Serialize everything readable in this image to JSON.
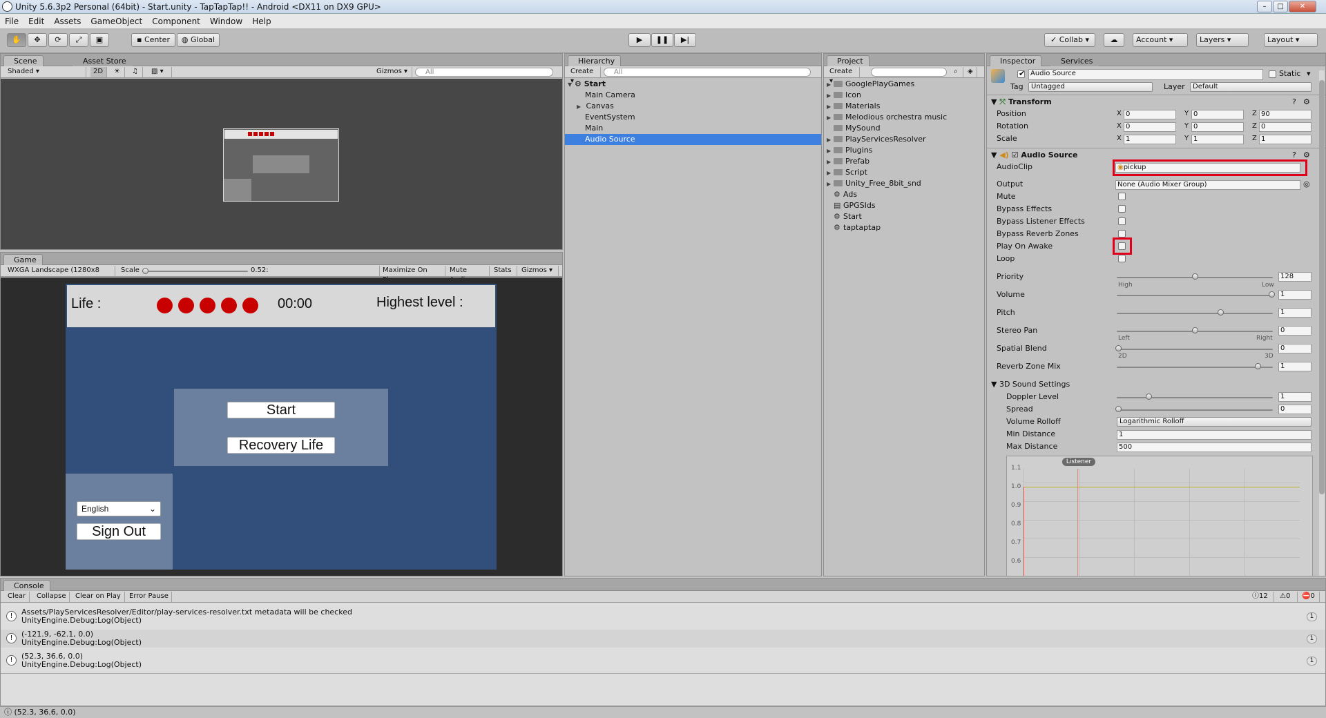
{
  "window": {
    "title": "Unity 5.6.3p2 Personal (64bit) - Start.unity - TapTapTap!! - Android <DX11 on DX9 GPU>"
  },
  "menu": [
    "File",
    "Edit",
    "Assets",
    "GameObject",
    "Component",
    "Window",
    "Help"
  ],
  "toolbar": {
    "center_label": "Center",
    "global_label": "Global",
    "collab_label": "Collab",
    "account_label": "Account",
    "layers_label": "Layers",
    "layout_label": "Layout"
  },
  "scene": {
    "tab_scene": "Scene",
    "tab_asset_store": "Asset Store",
    "shading": "Shaded",
    "mode_2d": "2D",
    "gizmos": "Gizmos",
    "search_placeholder": "All"
  },
  "game": {
    "tab": "Game",
    "resolution": "WXGA Landscape (1280x8",
    "scale_label": "Scale",
    "scale_value": "0.52:",
    "maximize": "Maximize On Play",
    "mute": "Mute Audio",
    "stats": "Stats",
    "gizmos": "Gizmos",
    "life_label": "Life :",
    "timer": "00:00",
    "highest_label": "Highest level :",
    "start_btn": "Start",
    "recovery_btn": "Recovery Life",
    "language": "English",
    "signout_btn": "Sign Out",
    "life_dots": 5,
    "colors": {
      "bg": "#324f7c",
      "header": "#d8d8d8",
      "dot": "#c80000",
      "panel": "#6b7f9e"
    }
  },
  "hierarchy": {
    "tab": "Hierarchy",
    "create": "Create",
    "search_placeholder": "All",
    "scene_name": "Start",
    "items": [
      "Main Camera",
      "Canvas",
      "EventSystem",
      "Main",
      "Audio Source"
    ],
    "selected": "Audio Source"
  },
  "project": {
    "tab": "Project",
    "create": "Create",
    "folders": [
      "GooglePlayGames",
      "Icon",
      "Materials",
      "Melodious orchestra music",
      "MySound",
      "PlayServicesResolver",
      "Plugins",
      "Prefab",
      "Script",
      "Unity_Free_8bit_snd"
    ],
    "files": [
      "Ads",
      "GPGSIds",
      "Start",
      "taptaptap"
    ]
  },
  "inspector": {
    "tab": "Inspector",
    "tab_services": "Services",
    "object_name": "Audio Source",
    "static_label": "Static",
    "tag_label": "Tag",
    "tag_value": "Untagged",
    "layer_label": "Layer",
    "layer_value": "Default",
    "transform": {
      "title": "Transform",
      "position_label": "Position",
      "position": [
        "0",
        "0",
        "90"
      ],
      "rotation_label": "Rotation",
      "rotation": [
        "0",
        "0",
        "0"
      ],
      "scale_label": "Scale",
      "scale": [
        "1",
        "1",
        "1"
      ]
    },
    "audio": {
      "title": "Audio Source",
      "audioclip_label": "AudioClip",
      "audioclip_value": "pickup",
      "output_label": "Output",
      "output_value": "None (Audio Mixer Group)",
      "mute_label": "Mute",
      "bypass_effects": "Bypass Effects",
      "bypass_listener": "Bypass Listener Effects",
      "bypass_reverb": "Bypass Reverb Zones",
      "play_on_awake": "Play On Awake",
      "loop": "Loop",
      "priority_label": "Priority",
      "priority_value": "128",
      "priority_high": "High",
      "priority_low": "Low",
      "volume_label": "Volume",
      "volume_value": "1",
      "pitch_label": "Pitch",
      "pitch_value": "1",
      "stereo_label": "Stereo Pan",
      "stereo_value": "0",
      "stereo_left": "Left",
      "stereo_right": "Right",
      "spatial_label": "Spatial Blend",
      "spatial_value": "0",
      "spatial_2d": "2D",
      "spatial_3d": "3D",
      "reverb_label": "Reverb Zone Mix",
      "reverb_value": "1",
      "sound3d_label": "3D Sound Settings",
      "doppler_label": "Doppler Level",
      "doppler_value": "1",
      "spread_label": "Spread",
      "spread_value": "0",
      "rolloff_label": "Volume Rolloff",
      "rolloff_value": "Logarithmic Rolloff",
      "min_label": "Min Distance",
      "min_value": "1",
      "max_label": "Max Distance",
      "max_value": "500",
      "graph_listener": "Listener",
      "graph_ticks": [
        "1.1",
        "1.0",
        "0.9",
        "0.8",
        "0.7",
        "0.6"
      ]
    }
  },
  "console": {
    "tab": "Console",
    "clear": "Clear",
    "collapse": "Collapse",
    "clear_on_play": "Clear on Play",
    "error_pause": "Error Pause",
    "count_info": "12",
    "count_warn": "0",
    "count_error": "0",
    "logs": [
      {
        "line1": "Assets/PlayServicesResolver/Editor/play-services-resolver.txt metadata will be checked",
        "line2": "UnityEngine.Debug:Log(Object)",
        "count": "1"
      },
      {
        "line1": "(-121.9, -62.1, 0.0)",
        "line2": "UnityEngine.Debug:Log(Object)",
        "count": "1"
      },
      {
        "line1": "(52.3, 36.6, 0.0)",
        "line2": "UnityEngine.Debug:Log(Object)",
        "count": "1"
      }
    ]
  },
  "statusbar": {
    "text": "(52.3, 36.6, 0.0)"
  }
}
